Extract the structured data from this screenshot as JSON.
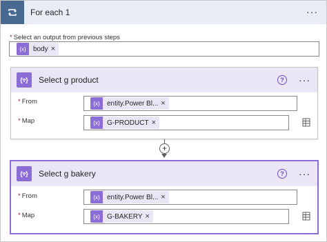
{
  "foreach": {
    "title": "For each 1",
    "more": "···"
  },
  "select_output": {
    "required_mark": "*",
    "label": "Select an output from previous steps",
    "token": {
      "text": "body",
      "icon": "expression-icon"
    }
  },
  "actions": [
    {
      "title": "Select g product",
      "help": "?",
      "more": "···",
      "from_label": "From",
      "map_label": "Map",
      "from_token": "entity.Power Bl...",
      "map_token": "G-PRODUCT"
    },
    {
      "title": "Select g bakery",
      "help": "?",
      "more": "···",
      "from_label": "From",
      "map_label": "Map",
      "from_token": "entity.Power Bl...",
      "map_token": "G-BAKERY"
    }
  ],
  "connector": {
    "plus": "+"
  },
  "colors": {
    "loop_accent": "#486991",
    "action_accent": "#8c6cd5",
    "token_bg": "#eae6f5",
    "required": "#a4262c"
  }
}
